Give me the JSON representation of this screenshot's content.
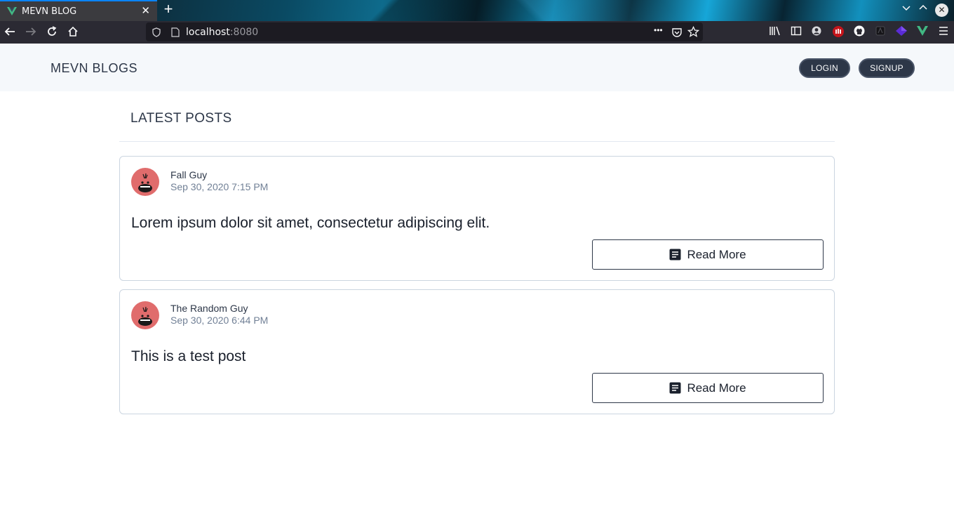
{
  "browser": {
    "tab_title": "MEVN BLOG",
    "tab_close": "✕",
    "new_tab": "+",
    "url_host": "localhost",
    "url_port": ":8080",
    "url_more": "•••"
  },
  "header": {
    "brand": "MEVN BLOGS",
    "login_label": "LOGIN",
    "signup_label": "SIGNUP"
  },
  "main": {
    "section_title": "LATEST POSTS",
    "posts": [
      {
        "author": "Fall Guy",
        "date": "Sep 30, 2020 7:15 PM",
        "text": "Lorem ipsum dolor sit amet, consectetur adipiscing elit.",
        "read_more": "Read More"
      },
      {
        "author": "The Random Guy",
        "date": "Sep 30, 2020 6:44 PM",
        "text": "This is a test post",
        "read_more": "Read More"
      }
    ]
  },
  "colors": {
    "accent": "#2d3748",
    "header_bg": "#f5f8fb",
    "avatar": "#e06c6c",
    "tab_highlight": "#0a84ff"
  }
}
